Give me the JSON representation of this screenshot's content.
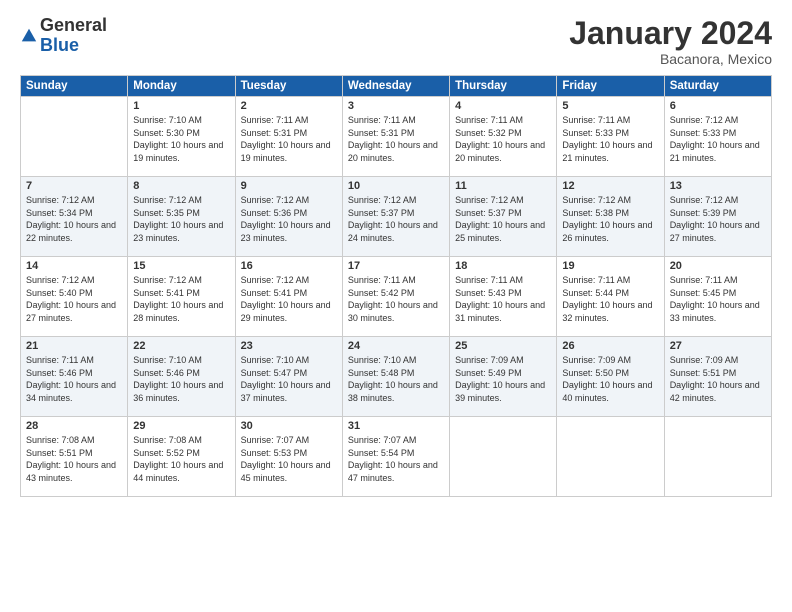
{
  "header": {
    "logo_general": "General",
    "logo_blue": "Blue",
    "month_title": "January 2024",
    "location": "Bacanora, Mexico"
  },
  "days_of_week": [
    "Sunday",
    "Monday",
    "Tuesday",
    "Wednesday",
    "Thursday",
    "Friday",
    "Saturday"
  ],
  "weeks": [
    [
      {
        "num": "",
        "sunrise": "",
        "sunset": "",
        "daylight": ""
      },
      {
        "num": "1",
        "sunrise": "Sunrise: 7:10 AM",
        "sunset": "Sunset: 5:30 PM",
        "daylight": "Daylight: 10 hours and 19 minutes."
      },
      {
        "num": "2",
        "sunrise": "Sunrise: 7:11 AM",
        "sunset": "Sunset: 5:31 PM",
        "daylight": "Daylight: 10 hours and 19 minutes."
      },
      {
        "num": "3",
        "sunrise": "Sunrise: 7:11 AM",
        "sunset": "Sunset: 5:31 PM",
        "daylight": "Daylight: 10 hours and 20 minutes."
      },
      {
        "num": "4",
        "sunrise": "Sunrise: 7:11 AM",
        "sunset": "Sunset: 5:32 PM",
        "daylight": "Daylight: 10 hours and 20 minutes."
      },
      {
        "num": "5",
        "sunrise": "Sunrise: 7:11 AM",
        "sunset": "Sunset: 5:33 PM",
        "daylight": "Daylight: 10 hours and 21 minutes."
      },
      {
        "num": "6",
        "sunrise": "Sunrise: 7:12 AM",
        "sunset": "Sunset: 5:33 PM",
        "daylight": "Daylight: 10 hours and 21 minutes."
      }
    ],
    [
      {
        "num": "7",
        "sunrise": "Sunrise: 7:12 AM",
        "sunset": "Sunset: 5:34 PM",
        "daylight": "Daylight: 10 hours and 22 minutes."
      },
      {
        "num": "8",
        "sunrise": "Sunrise: 7:12 AM",
        "sunset": "Sunset: 5:35 PM",
        "daylight": "Daylight: 10 hours and 23 minutes."
      },
      {
        "num": "9",
        "sunrise": "Sunrise: 7:12 AM",
        "sunset": "Sunset: 5:36 PM",
        "daylight": "Daylight: 10 hours and 23 minutes."
      },
      {
        "num": "10",
        "sunrise": "Sunrise: 7:12 AM",
        "sunset": "Sunset: 5:37 PM",
        "daylight": "Daylight: 10 hours and 24 minutes."
      },
      {
        "num": "11",
        "sunrise": "Sunrise: 7:12 AM",
        "sunset": "Sunset: 5:37 PM",
        "daylight": "Daylight: 10 hours and 25 minutes."
      },
      {
        "num": "12",
        "sunrise": "Sunrise: 7:12 AM",
        "sunset": "Sunset: 5:38 PM",
        "daylight": "Daylight: 10 hours and 26 minutes."
      },
      {
        "num": "13",
        "sunrise": "Sunrise: 7:12 AM",
        "sunset": "Sunset: 5:39 PM",
        "daylight": "Daylight: 10 hours and 27 minutes."
      }
    ],
    [
      {
        "num": "14",
        "sunrise": "Sunrise: 7:12 AM",
        "sunset": "Sunset: 5:40 PM",
        "daylight": "Daylight: 10 hours and 27 minutes."
      },
      {
        "num": "15",
        "sunrise": "Sunrise: 7:12 AM",
        "sunset": "Sunset: 5:41 PM",
        "daylight": "Daylight: 10 hours and 28 minutes."
      },
      {
        "num": "16",
        "sunrise": "Sunrise: 7:12 AM",
        "sunset": "Sunset: 5:41 PM",
        "daylight": "Daylight: 10 hours and 29 minutes."
      },
      {
        "num": "17",
        "sunrise": "Sunrise: 7:11 AM",
        "sunset": "Sunset: 5:42 PM",
        "daylight": "Daylight: 10 hours and 30 minutes."
      },
      {
        "num": "18",
        "sunrise": "Sunrise: 7:11 AM",
        "sunset": "Sunset: 5:43 PM",
        "daylight": "Daylight: 10 hours and 31 minutes."
      },
      {
        "num": "19",
        "sunrise": "Sunrise: 7:11 AM",
        "sunset": "Sunset: 5:44 PM",
        "daylight": "Daylight: 10 hours and 32 minutes."
      },
      {
        "num": "20",
        "sunrise": "Sunrise: 7:11 AM",
        "sunset": "Sunset: 5:45 PM",
        "daylight": "Daylight: 10 hours and 33 minutes."
      }
    ],
    [
      {
        "num": "21",
        "sunrise": "Sunrise: 7:11 AM",
        "sunset": "Sunset: 5:46 PM",
        "daylight": "Daylight: 10 hours and 34 minutes."
      },
      {
        "num": "22",
        "sunrise": "Sunrise: 7:10 AM",
        "sunset": "Sunset: 5:46 PM",
        "daylight": "Daylight: 10 hours and 36 minutes."
      },
      {
        "num": "23",
        "sunrise": "Sunrise: 7:10 AM",
        "sunset": "Sunset: 5:47 PM",
        "daylight": "Daylight: 10 hours and 37 minutes."
      },
      {
        "num": "24",
        "sunrise": "Sunrise: 7:10 AM",
        "sunset": "Sunset: 5:48 PM",
        "daylight": "Daylight: 10 hours and 38 minutes."
      },
      {
        "num": "25",
        "sunrise": "Sunrise: 7:09 AM",
        "sunset": "Sunset: 5:49 PM",
        "daylight": "Daylight: 10 hours and 39 minutes."
      },
      {
        "num": "26",
        "sunrise": "Sunrise: 7:09 AM",
        "sunset": "Sunset: 5:50 PM",
        "daylight": "Daylight: 10 hours and 40 minutes."
      },
      {
        "num": "27",
        "sunrise": "Sunrise: 7:09 AM",
        "sunset": "Sunset: 5:51 PM",
        "daylight": "Daylight: 10 hours and 42 minutes."
      }
    ],
    [
      {
        "num": "28",
        "sunrise": "Sunrise: 7:08 AM",
        "sunset": "Sunset: 5:51 PM",
        "daylight": "Daylight: 10 hours and 43 minutes."
      },
      {
        "num": "29",
        "sunrise": "Sunrise: 7:08 AM",
        "sunset": "Sunset: 5:52 PM",
        "daylight": "Daylight: 10 hours and 44 minutes."
      },
      {
        "num": "30",
        "sunrise": "Sunrise: 7:07 AM",
        "sunset": "Sunset: 5:53 PM",
        "daylight": "Daylight: 10 hours and 45 minutes."
      },
      {
        "num": "31",
        "sunrise": "Sunrise: 7:07 AM",
        "sunset": "Sunset: 5:54 PM",
        "daylight": "Daylight: 10 hours and 47 minutes."
      },
      {
        "num": "",
        "sunrise": "",
        "sunset": "",
        "daylight": ""
      },
      {
        "num": "",
        "sunrise": "",
        "sunset": "",
        "daylight": ""
      },
      {
        "num": "",
        "sunrise": "",
        "sunset": "",
        "daylight": ""
      }
    ]
  ]
}
